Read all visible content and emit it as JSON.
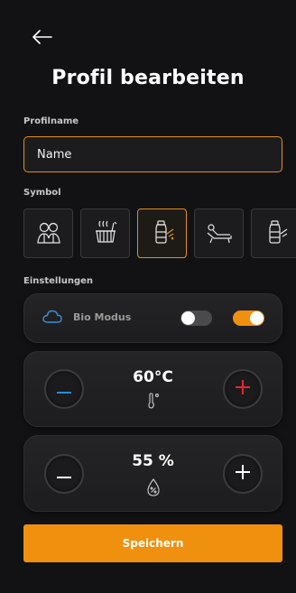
{
  "header": {
    "title": "Profil bearbeiten"
  },
  "profile_name": {
    "label": "Profilname",
    "value": "Name"
  },
  "symbols": {
    "label": "Symbol",
    "items": [
      "people-icon",
      "sauna-bucket-icon",
      "water-bottle-icon",
      "lounger-icon",
      "bottle-icon"
    ],
    "selected_index": 2
  },
  "settings": {
    "label": "Einstellungen",
    "bio_mode": {
      "label": "Bio Modus",
      "toggle_left": "off",
      "toggle_right": "on"
    },
    "temperature": {
      "value": "60°C"
    },
    "humidity": {
      "value": "55 %"
    }
  },
  "save": {
    "label": "Speichern"
  },
  "colors": {
    "accent": "#f0900f",
    "minus_temp": "#1f8fe0",
    "plus_temp": "#e02a2a",
    "cloud": "#3a8fd8"
  }
}
